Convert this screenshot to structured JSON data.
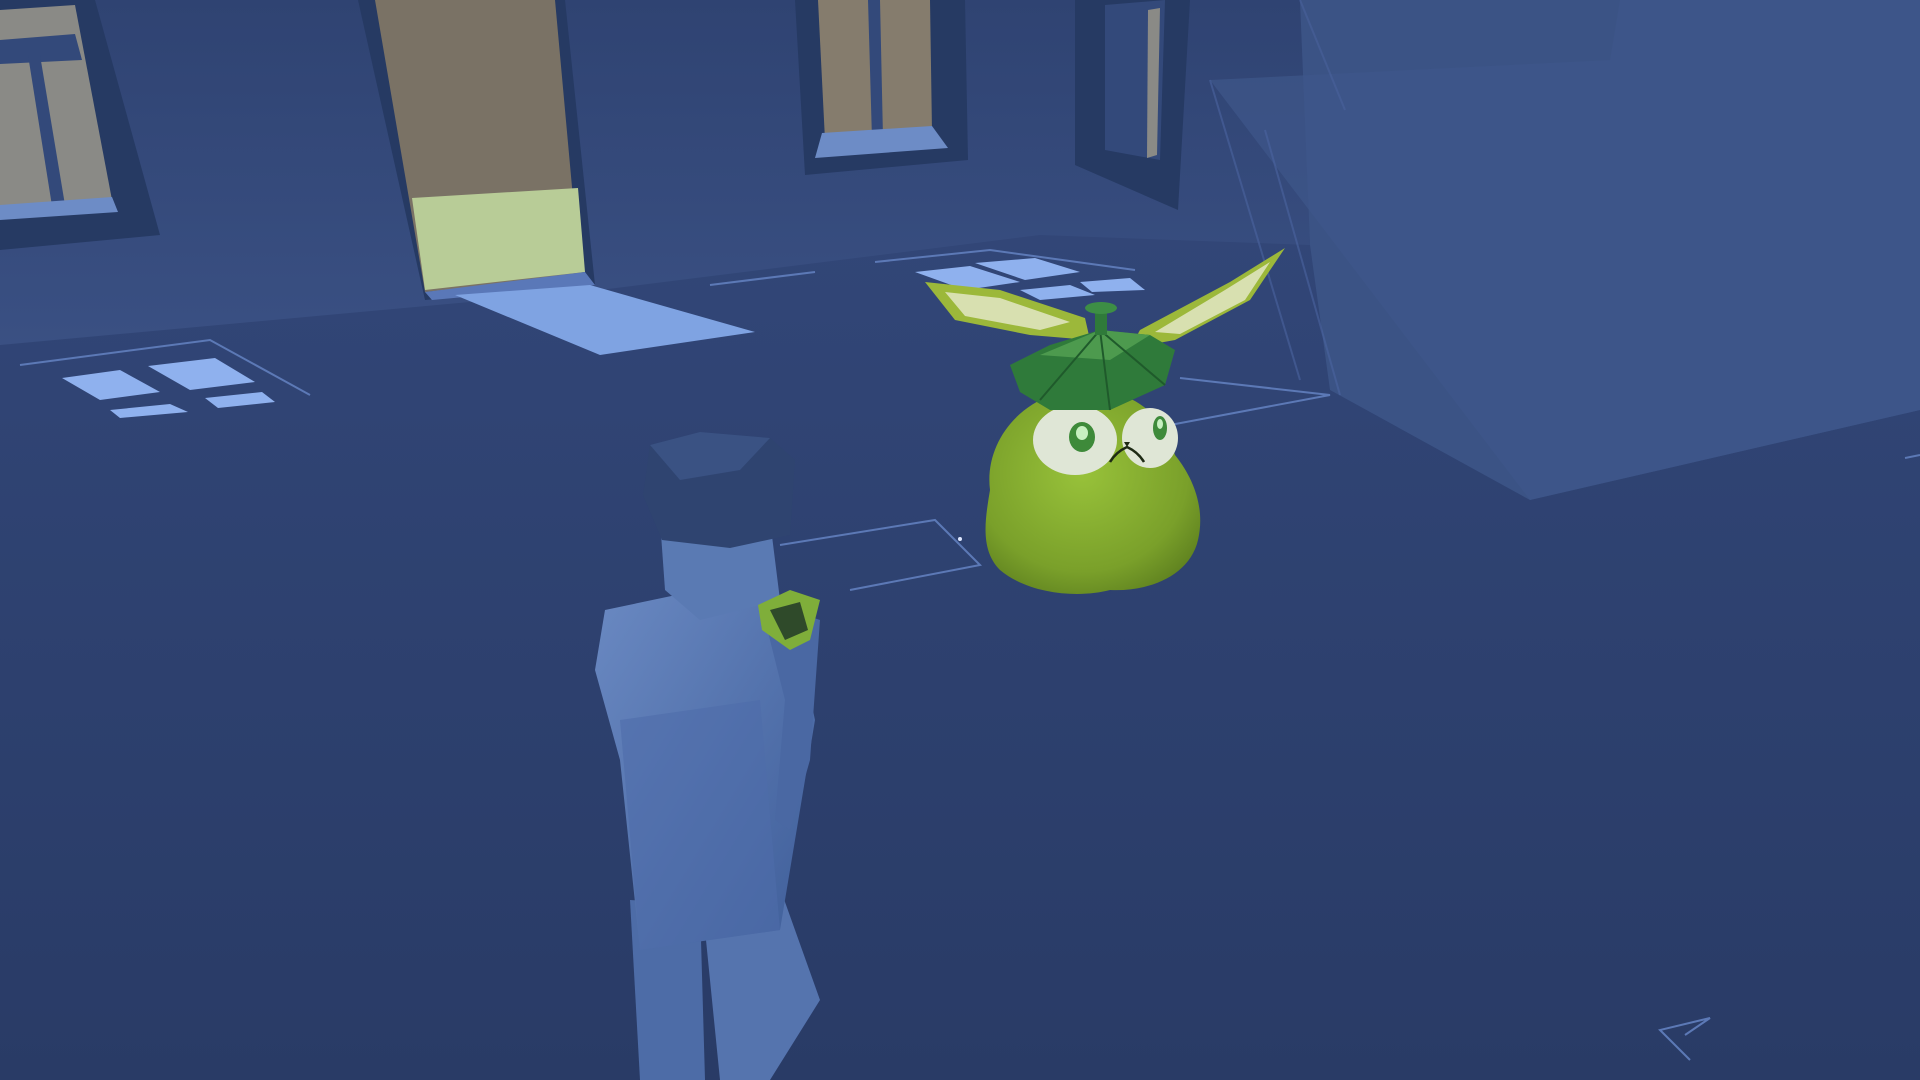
{
  "scene": {
    "view": "third-person",
    "environment": "blue-room-interior",
    "colors": {
      "floor": "#2f4373",
      "back_wall": "#34497a",
      "right_wall": "#3a5283",
      "window_light": "#86a9e6",
      "doorway_outside": "#7d766a",
      "doorway_grass": "#b9cc98",
      "player_body": "#5676b0",
      "player_hat": "#2f4470",
      "creature_body": "#7ea42a",
      "creature_leaf": "#2f7a3a",
      "creature_ears": "#9cb83a"
    }
  },
  "player": {
    "icon": "player-character"
  },
  "creature": {
    "icon": "green-pear-bunny-creature"
  },
  "crosshair": {
    "icon": "crosshair-dot"
  }
}
